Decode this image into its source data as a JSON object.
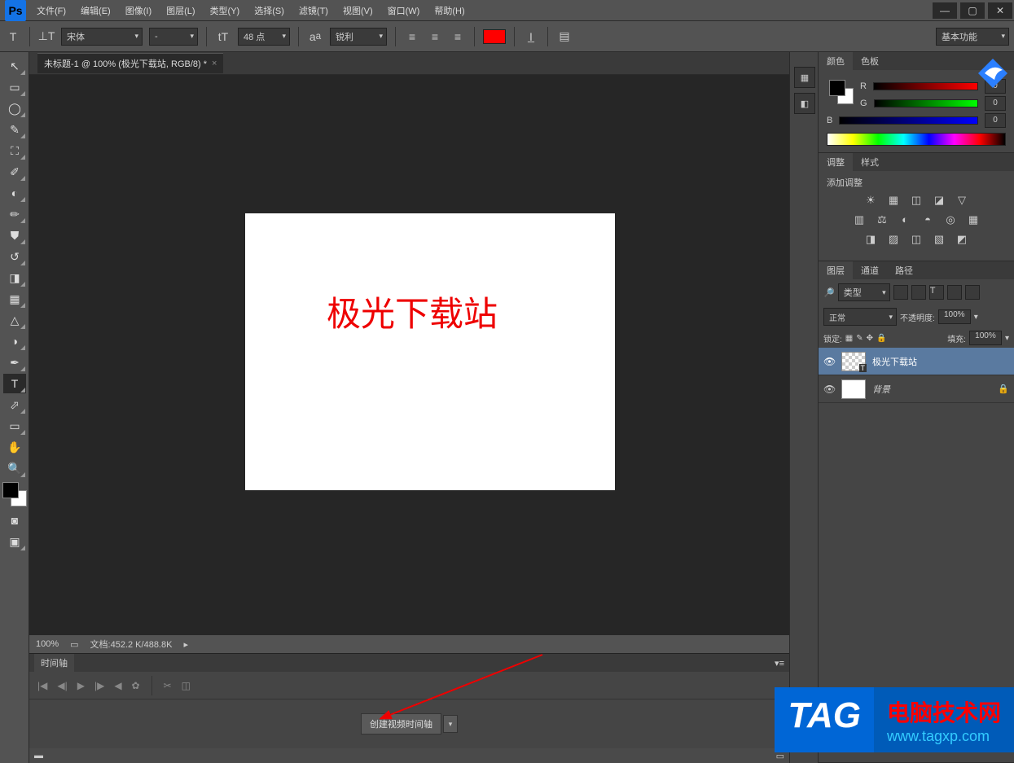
{
  "menubar": {
    "items": [
      "文件(F)",
      "编辑(E)",
      "图像(I)",
      "图层(L)",
      "类型(Y)",
      "选择(S)",
      "滤镜(T)",
      "视图(V)",
      "窗口(W)",
      "帮助(H)"
    ]
  },
  "options": {
    "font": "宋体",
    "font_style": "-",
    "size_value": "48 点",
    "aa": "锐利",
    "swatch": "#ff0000",
    "workspace": "基本功能"
  },
  "document": {
    "tab": "未标题-1 @ 100% (极光下载站, RGB/8) *",
    "canvas_text": "极光下载站"
  },
  "status": {
    "zoom": "100%",
    "doc": "文档:452.2 K/488.8K"
  },
  "timeline": {
    "tab": "时间轴",
    "create_btn": "创建视频时间轴"
  },
  "panels": {
    "color_tabs": [
      "颜色",
      "色板"
    ],
    "rgb": {
      "r_label": "R",
      "g_label": "G",
      "b_label": "B",
      "r": "0",
      "g": "0",
      "b": "0"
    },
    "adjust_tabs": [
      "调整",
      "样式"
    ],
    "adjust_title": "添加调整",
    "layers_tabs": [
      "图层",
      "通道",
      "路径"
    ],
    "layer_filter": "类型",
    "blend_mode": "正常",
    "opacity_label": "不透明度:",
    "opacity": "100%",
    "lock_label": "锁定:",
    "fill_label": "填充:",
    "fill": "100%",
    "layers": [
      {
        "name": "极光下载站"
      },
      {
        "name": "背景"
      }
    ]
  },
  "overlay": {
    "tag": "TAG",
    "site": "电脑技术网",
    "url": "www.tagxp.com"
  }
}
